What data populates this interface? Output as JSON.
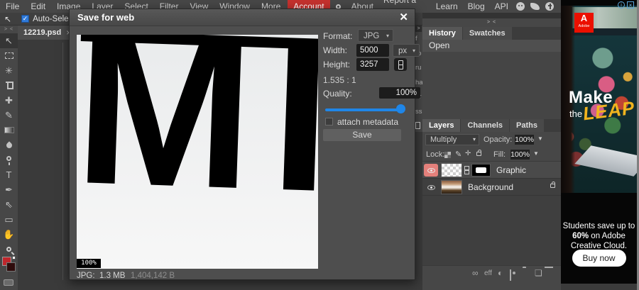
{
  "ui": {
    "arrow_down": "▼",
    "dropdown": "▾",
    "collapse_pair": "> <",
    "chev": ">",
    "close": "✕",
    "tab_close": "×",
    "check": "✓"
  },
  "menubar": {
    "items": [
      "File",
      "Edit",
      "Image",
      "Layer",
      "Select",
      "Filter",
      "View",
      "Window",
      "More",
      "Account"
    ],
    "right_items": [
      "About",
      "Report a bug",
      "Learn",
      "Blog",
      "API"
    ],
    "account_color": "#c4312e"
  },
  "options_bar": {
    "tool_glyph": "↖",
    "auto_select": "Auto-Select",
    "auto_select_checked": true
  },
  "document_tab": {
    "title": "12219.psd"
  },
  "toolbar": {
    "tools": [
      {
        "name": "move-tool",
        "glyph": "↖",
        "selected": true
      },
      {
        "name": "rect-select-tool",
        "glyph": ""
      },
      {
        "name": "magic-wand-tool",
        "glyph": "✳"
      },
      {
        "name": "crop-tool",
        "glyph": ""
      },
      {
        "name": "healing-brush-tool",
        "glyph": "✚"
      },
      {
        "name": "brush-tool",
        "glyph": "✎"
      },
      {
        "name": "gradient-tool",
        "glyph": ""
      },
      {
        "name": "blur-tool",
        "glyph": ""
      },
      {
        "name": "dodge-tool",
        "glyph": ""
      },
      {
        "name": "type-tool",
        "glyph": "T"
      },
      {
        "name": "pen-tool",
        "glyph": "✒"
      },
      {
        "name": "path-select-tool",
        "glyph": "⇖"
      },
      {
        "name": "rectangle-tool",
        "glyph": "▭"
      },
      {
        "name": "hand-tool",
        "glyph": "✋"
      },
      {
        "name": "zoom-tool",
        "glyph": ""
      }
    ],
    "foreground_color": "#c0262c",
    "background_color": "#2f0c0c"
  },
  "dialog": {
    "title": "Save for web",
    "format_label": "Format:",
    "format_value": "JPG",
    "width_label": "Width:",
    "width_value": "5000",
    "unit_value": "px",
    "height_label": "Height:",
    "height_value": "3257",
    "ratio": "1.535 : 1",
    "quality_label": "Quality:",
    "quality_value": "100%",
    "metadata_label": "attach metadata",
    "metadata_checked": false,
    "save_label": "Save",
    "preview_letters": "MI",
    "zoom_badge": "100%",
    "status_format": "JPG:",
    "status_size": "1.3 MB",
    "status_bytes": "1,404,142 B",
    "slider_color": "#1f86e8"
  },
  "clipped_panel": {
    "fragments": [
      "f",
      "ro",
      "ru",
      "ha",
      "ar",
      "ss"
    ]
  },
  "right_panel": {
    "history_tabs": [
      "History",
      "Swatches"
    ],
    "history_items": [
      "Open"
    ],
    "layers_tabs": [
      "Layers",
      "Channels",
      "Paths"
    ],
    "blend_mode": "Multiply",
    "opacity_label": "Opacity:",
    "opacity_value": "100%",
    "lock_label": "Lock:",
    "fill_label": "Fill:",
    "fill_value": "100%",
    "layers": [
      {
        "name": "Graphic",
        "selected": true,
        "has_mask": true
      },
      {
        "name": "Background",
        "locked": true
      }
    ],
    "footer": {
      "link": "∞",
      "effects": "eff",
      "adjust": "◐",
      "new_layer": "❏"
    },
    "selected_eye_color": "#e4807b"
  },
  "ad": {
    "brand": "Adobe",
    "logo_glyph": "A",
    "info_glyph": "i",
    "close_glyph": "×",
    "headline_word1": "Make",
    "headline_word2": "the",
    "headline_word3": "LEAP",
    "line1": "Students save up to",
    "pct": "60%",
    "line2": " on Adobe",
    "line3": "Creative Cloud.",
    "cta": "Buy now",
    "yellow": "#f0b41e",
    "adobe_red": "#eb1000"
  }
}
